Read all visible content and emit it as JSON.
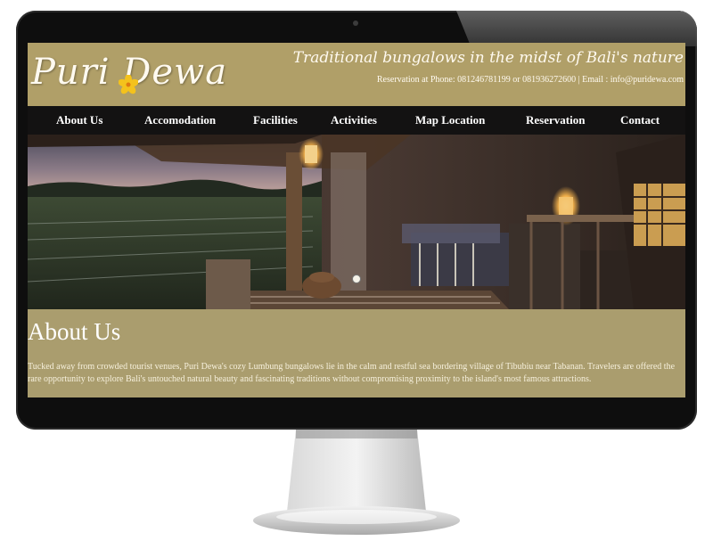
{
  "site": {
    "logo_text": "Puri Dewa",
    "tagline": "Traditional bungalows in the midst of Bali's nature",
    "contact_line": "Reservation at Phone: 081246781199 or 081936272600 | Email : info@puridewa.com"
  },
  "nav": {
    "items": [
      {
        "label": "About Us"
      },
      {
        "label": "Accomodation"
      },
      {
        "label": "Facilities"
      },
      {
        "label": "Activities"
      },
      {
        "label": "Map Location"
      },
      {
        "label": "Reservation"
      },
      {
        "label": "Contact"
      }
    ]
  },
  "content": {
    "title": "About Us",
    "body": "Tucked away from crowded tourist venues, Puri Dewa's cozy Lumbung bungalows lie in the calm and restful sea bordering village of Tibubiu near Tabanan. Travelers are offered the rare opportunity to explore Bali's untouched natural beauty and fascinating traditions without compromising proximity to the island's most famous attractions."
  },
  "slider": {
    "active_index": 0,
    "count": 1
  },
  "colors": {
    "header_bg": "#b09f68",
    "nav_bg": "#131212",
    "content_bg": "#aa9d6e",
    "bezel": "#0e0e0e"
  }
}
